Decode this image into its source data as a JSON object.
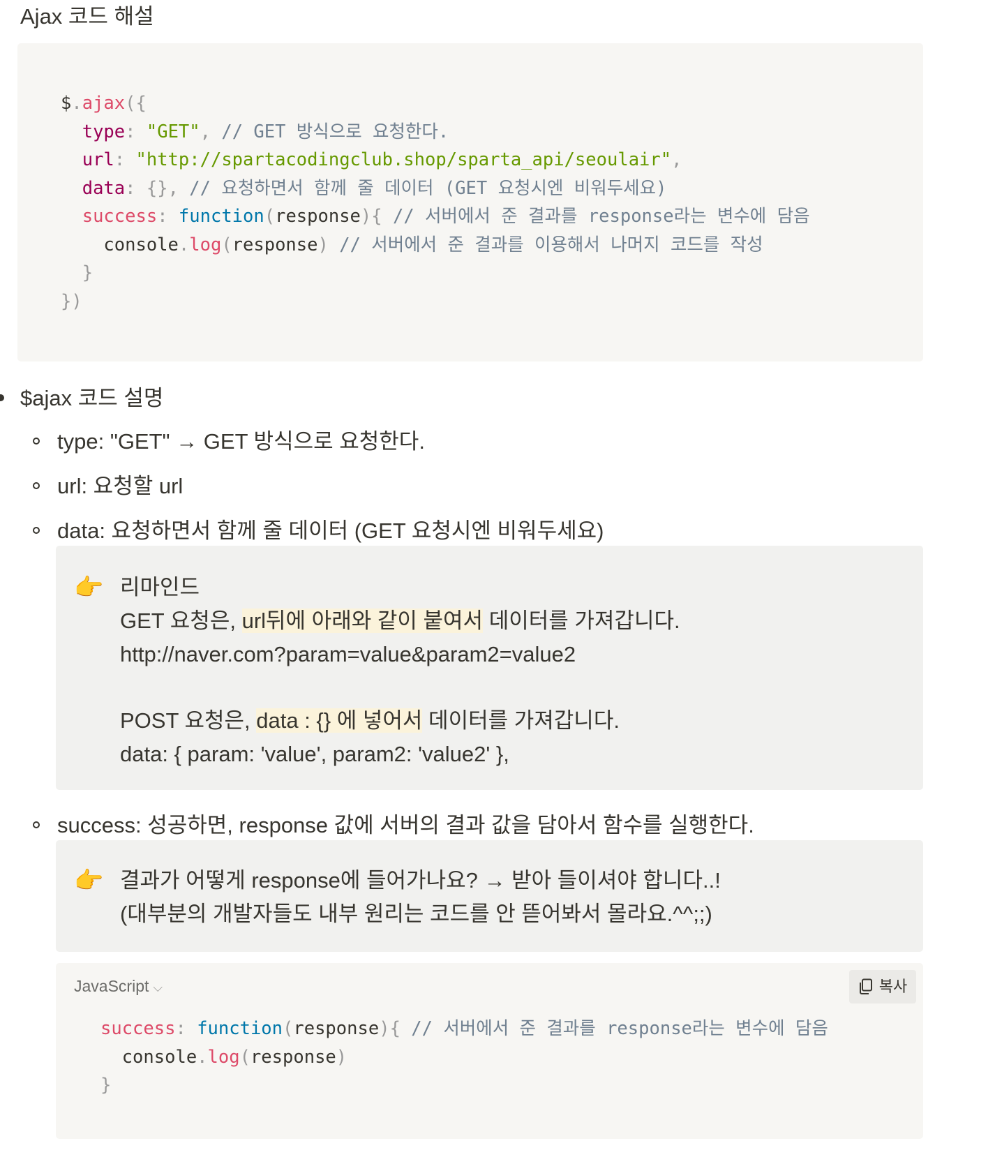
{
  "heading": "Ajax 코드 해설",
  "code_block_1": {
    "lines": [
      "$.ajax({",
      "  type: \"GET\", // GET 방식으로 요청한다.",
      "  url: \"http://spartacodingclub.shop/sparta_api/seoulair\",",
      "  data: {}, // 요청하면서 함께 줄 데이터 (GET 요청시엔 비워두세요)",
      "  success: function(response){ // 서버에서 준 결과를 response라는 변수에 담음",
      "    console.log(response) // 서버에서 준 결과를 이용해서 나머지 코드를 작성",
      "  }",
      "})"
    ]
  },
  "list": {
    "title": "$ajax 코드 설명",
    "items": [
      "type: \"GET\" → GET 방식으로 요청한다.",
      "url: 요청할 url",
      "data: 요청하면서 함께 줄 데이터 (GET 요청시엔 비워두세요)",
      "success: 성공하면, response 값에 서버의 결과 값을 담아서 함수를 실행한다."
    ]
  },
  "callout_1": {
    "icon": "pointing-hand-icon",
    "title": "리마인드",
    "get_prefix": "GET 요청은, ",
    "get_highlight": "url뒤에 아래와 같이 붙여서",
    "get_suffix": " 데이터를 가져갑니다.",
    "get_example": "http://naver.com?param=value&param2=value2",
    "post_prefix": "POST 요청은, ",
    "post_highlight": "data : {} 에 넣어서",
    "post_suffix": " 데이터를 가져갑니다.",
    "post_example": "data: { param: 'value', param2: 'value2' },"
  },
  "callout_2": {
    "icon": "pointing-hand-icon",
    "line1": "결과가 어떻게 response에 들어가나요? → 받아 들이셔야 합니다..!",
    "line2": "(대부분의 개발자들도 내부 원리는 코드를 안 뜯어봐서 몰라요.^^;;)"
  },
  "code_block_2": {
    "language": "JavaScript",
    "copy_label": "복사",
    "lines": [
      "success: function(response){ // 서버에서 준 결과를 response라는 변수에 담음",
      "  console.log(response)",
      "}"
    ]
  },
  "colors": {
    "code_background": "#f7f6f3",
    "callout_background": "#f1f1ef",
    "highlight": "#fbf3db",
    "token_property": "#990055",
    "token_string": "#669900",
    "token_keyword": "#0077aa",
    "token_comment": "#708090",
    "token_function": "#DD4A68"
  }
}
